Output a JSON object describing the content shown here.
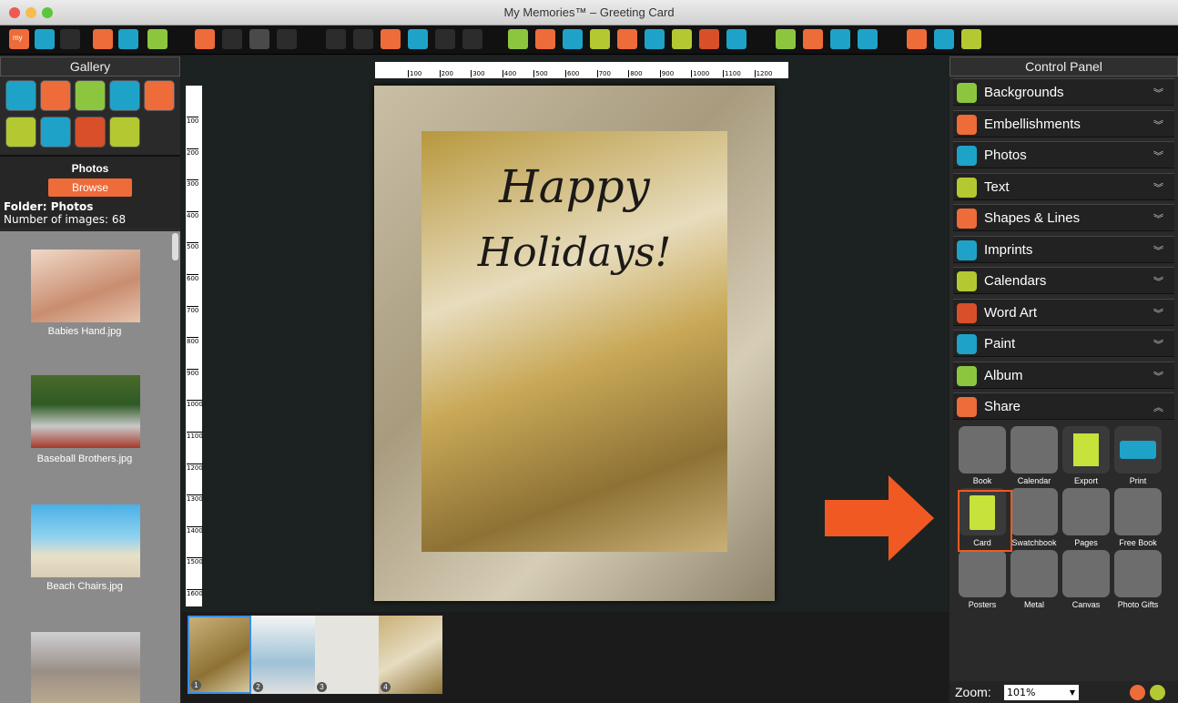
{
  "window": {
    "title": "My Memories™ – Greeting Card"
  },
  "gallery": {
    "title": "Gallery"
  },
  "photos": {
    "title": "Photos",
    "browse_label": "Browse",
    "folder": "Folder: Photos",
    "count": "Number of images: 68",
    "items": [
      {
        "name": "Babies Hand.jpg"
      },
      {
        "name": "Baseball Brothers.jpg"
      },
      {
        "name": "Beach Chairs.jpg"
      }
    ]
  },
  "card": {
    "line1": "Happy",
    "line2": "Holidays!"
  },
  "ruler": {
    "top": [
      "100",
      "200",
      "300",
      "400",
      "500",
      "600",
      "700",
      "800",
      "900",
      "1000",
      "1100",
      "1200"
    ],
    "left": [
      "100",
      "200",
      "300",
      "400",
      "500",
      "600",
      "700",
      "800",
      "900",
      "1000",
      "1100",
      "1200",
      "1300",
      "1400",
      "1500",
      "1600"
    ]
  },
  "pages": [
    "1",
    "2",
    "3",
    "4"
  ],
  "panel": {
    "title": "Control Panel",
    "sections": [
      {
        "label": "Backgrounds",
        "icon": "backgrounds-icon",
        "color": "#8cc63f"
      },
      {
        "label": "Embellishments",
        "icon": "flower-icon",
        "color": "#ee6b3a"
      },
      {
        "label": "Photos",
        "icon": "camera-icon",
        "color": "#1fa2c8"
      },
      {
        "label": "Text",
        "icon": "text-icon",
        "color": "#b4c832"
      },
      {
        "label": "Shapes & Lines",
        "icon": "star-icon",
        "color": "#ee6b3a"
      },
      {
        "label": "Imprints",
        "icon": "butterfly-icon",
        "color": "#1fa2c8"
      },
      {
        "label": "Calendars",
        "icon": "calendar-icon",
        "color": "#b4c832"
      },
      {
        "label": "Word Art",
        "icon": "word-art-icon",
        "color": "#d94f2a"
      },
      {
        "label": "Paint",
        "icon": "brush-icon",
        "color": "#1fa2c8"
      },
      {
        "label": "Album",
        "icon": "album-icon",
        "color": "#8cc63f"
      },
      {
        "label": "Share",
        "icon": "share-icon",
        "color": "#ee6b3a"
      }
    ],
    "share_items": [
      "Book",
      "Calendar",
      "Export",
      "Print",
      "Card",
      "Swatchbook",
      "Pages",
      "Free Book",
      "Posters",
      "Metal",
      "Canvas",
      "Photo Gifts"
    ]
  },
  "zoom": {
    "label": "Zoom:",
    "value": "101%"
  },
  "colors": {
    "accent": "#ee6b3a",
    "teal": "#1fa2c8",
    "green": "#8cc63f"
  }
}
